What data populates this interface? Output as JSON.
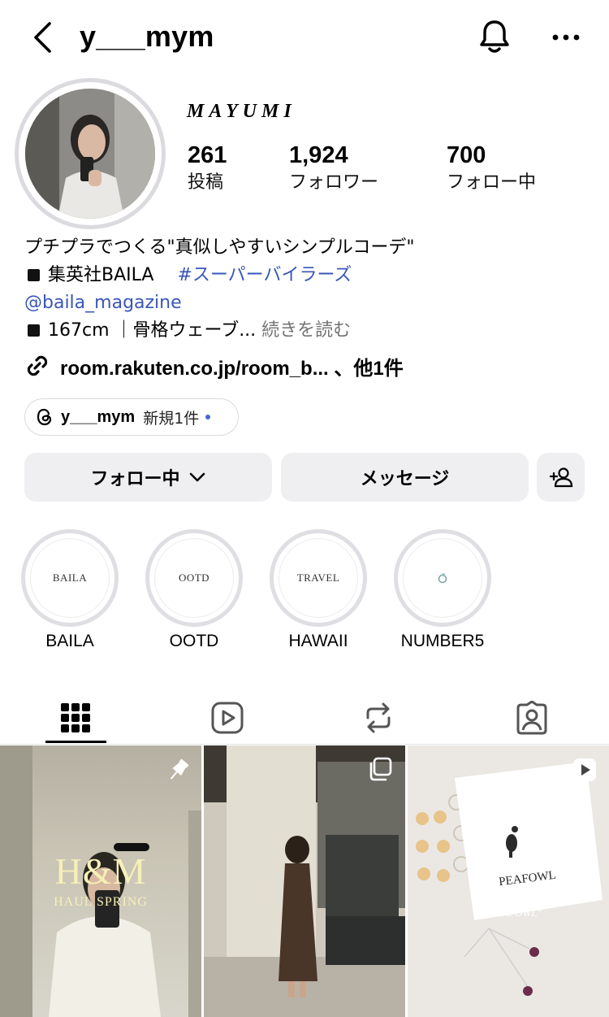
{
  "header": {
    "username": "y___mym",
    "back_icon": "chevron-left-icon",
    "bell_icon": "bell-icon",
    "more_icon": "ellipsis-icon"
  },
  "profile": {
    "display_name": "MAYUMI",
    "stats": [
      {
        "value": "261",
        "label": "投稿"
      },
      {
        "value": "1,924",
        "label": "フォロワー"
      },
      {
        "value": "700",
        "label": "フォロー中"
      }
    ]
  },
  "bio": {
    "line1": "プチプラでつくる\"真似しやすいシンプルコーデ\"",
    "line2_text": "集英社BAILA",
    "line2_hashtag": "#スーパーバイラーズ",
    "line3_mention": "@baila_magazine",
    "line4_text": "167cm ｜骨格ウェーブ...",
    "line4_more": "続きを読む"
  },
  "link": {
    "text": "room.rakuten.co.jp/room_b... 、他1件"
  },
  "threads": {
    "name": "y___mym",
    "new_label": "新規1件"
  },
  "actions": {
    "follow_label": "フォロー中",
    "message_label": "メッセージ"
  },
  "highlights": [
    {
      "cover_text": "BAILA",
      "label": "BAILA"
    },
    {
      "cover_text": "OOTD",
      "label": "OOTD"
    },
    {
      "cover_text": "TRAVEL",
      "label": "HAWAII"
    },
    {
      "cover_text": "",
      "label": "NUMBER5"
    }
  ],
  "tabs": [
    "grid-icon",
    "reels-icon",
    "reposts-icon",
    "tagged-icon"
  ],
  "posts": [
    {
      "overlay_title": "H&M",
      "overlay_subtitle": "HAUL SPRING",
      "badge": "pin-icon"
    },
    {
      "overlay_title": "",
      "overlay_subtitle": "",
      "badge": "carousel-icon"
    },
    {
      "overlay_title": "PEAFOWL",
      "overlay_subtitle": "\"PEAFOWL\"",
      "badge": "reel-icon"
    }
  ],
  "colors": {
    "link_blue": "#3a56b8",
    "button_bg": "#efeff1",
    "threads_dot": "#4a63d6"
  }
}
